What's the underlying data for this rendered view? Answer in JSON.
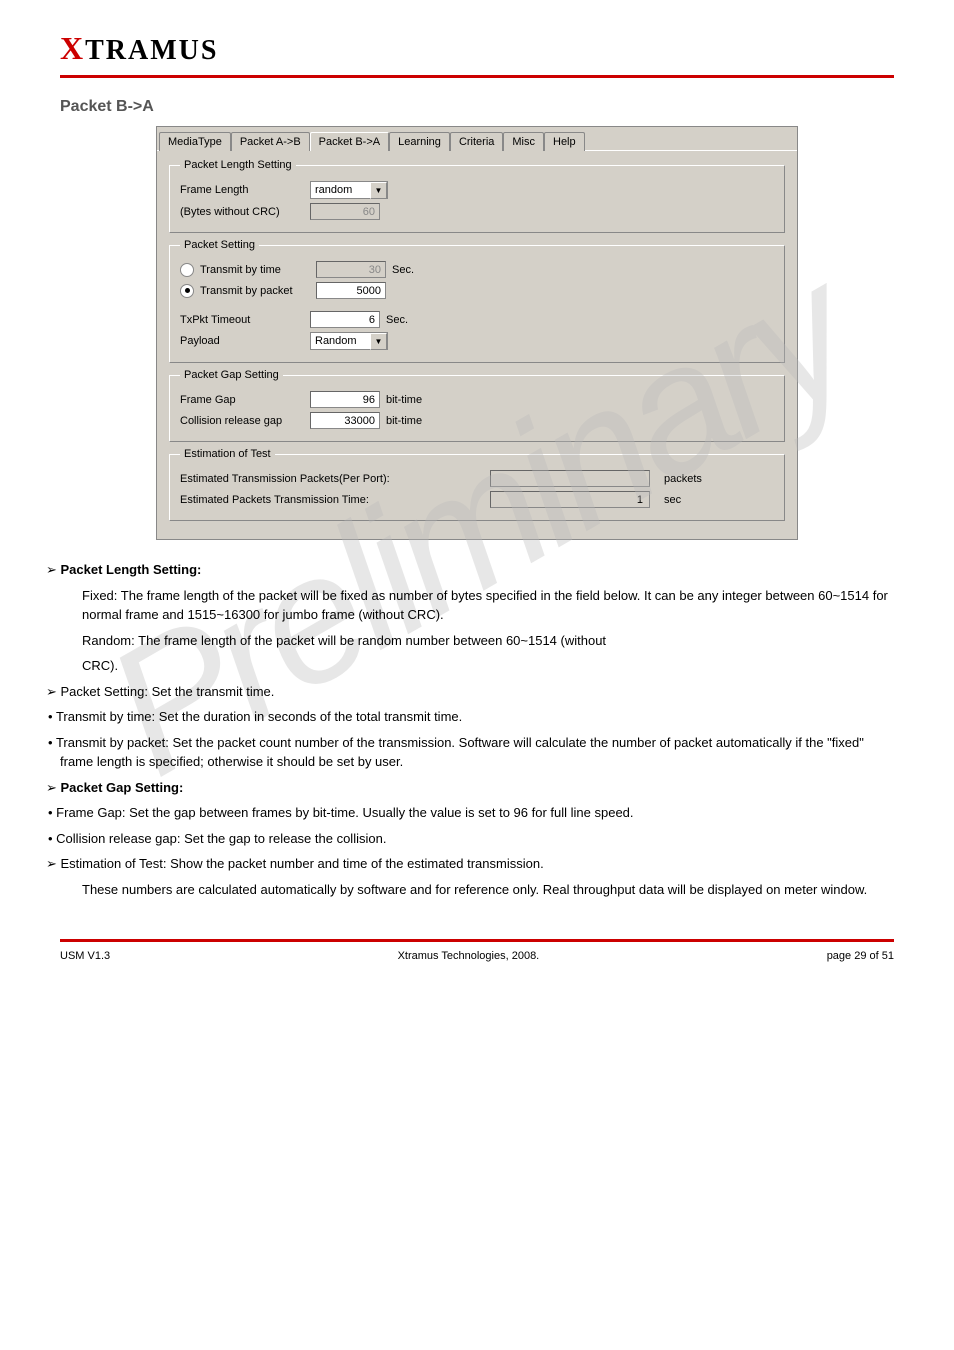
{
  "brand": {
    "x": "X",
    "rest": "TRAMUS"
  },
  "heading": "Packet B->A",
  "watermark": "Preliminary",
  "dialog": {
    "tabs": [
      {
        "label": "MediaType"
      },
      {
        "label": "Packet A->B"
      },
      {
        "label": "Packet B->A",
        "active": true
      },
      {
        "label": "Learning"
      },
      {
        "label": "Criteria"
      },
      {
        "label": "Misc"
      },
      {
        "label": "Help"
      }
    ],
    "packetLength": {
      "legend": "Packet Length Setting",
      "frameLengthLabel": "Frame Length",
      "frameLengthValue": "random",
      "bytesLabel": "(Bytes without CRC)",
      "bytesValue": "60"
    },
    "packetSetting": {
      "legend": "Packet Setting",
      "transmitByTimeLabel": "Transmit by time",
      "transmitByTimeValue": "30",
      "transmitByTimeUnit": "Sec.",
      "transmitByPacketLabel": "Transmit by packet",
      "transmitByPacketValue": "5000",
      "txPktTimeoutLabel": "TxPkt Timeout",
      "txPktTimeoutValue": "6",
      "txPktTimeoutUnit": "Sec.",
      "payloadLabel": "Payload",
      "payloadValue": "Random"
    },
    "packetGap": {
      "legend": "Packet Gap Setting",
      "frameGapLabel": "Frame Gap",
      "frameGapValue": "96",
      "frameGapUnit": "bit-time",
      "collisionLabel": "Collision release gap",
      "collisionValue": "33000",
      "collisionUnit": "bit-time"
    },
    "estimation": {
      "legend": "Estimation of Test",
      "packetsLabel": "Estimated Transmission Packets(Per Port):",
      "packetsValue": "",
      "packetsUnit": "packets",
      "timeLabel": "Estimated Packets Transmission Time:",
      "timeValue": "1",
      "timeUnit": "sec"
    }
  },
  "text": {
    "pls_heading": "Packet Length Setting:",
    "pls_fixed": "Fixed: The frame length of the packet will be fixed as number of bytes specified in the field below. It can be any integer between 60~1514 for normal frame and 1515~16300 for jumbo frame (without CRC).",
    "pls_random1": "Random: The frame length of the packet will be random number between 60~1514 (without",
    "pls_random2": "CRC).",
    "ps_heading": "Packet Setting: Set the transmit time.",
    "ps_time": "Transmit by time: Set the duration in seconds of the total transmit time.",
    "ps_packet": "Transmit by packet: Set the packet count number of the transmission. Software will calculate the number of packet automatically if the \"fixed\" frame length is specified; otherwise it should be set by user.",
    "pgs_heading": "Packet Gap Setting:",
    "pgs_frame": "Frame Gap: Set the gap between frames by bit-time. Usually the value is set to 96 for full line speed.",
    "pgs_collision": "Collision release gap: Set the gap to release the collision.",
    "est_heading": "Estimation of Test: Show the packet number and time of the estimated transmission.",
    "est_body": "These numbers are calculated automatically by software and for reference only. Real throughput data will be displayed on meter window."
  },
  "footer": {
    "left": "USM V1.3",
    "center": "Xtramus Technologies, 2008.",
    "right": "page 29 of 51"
  }
}
